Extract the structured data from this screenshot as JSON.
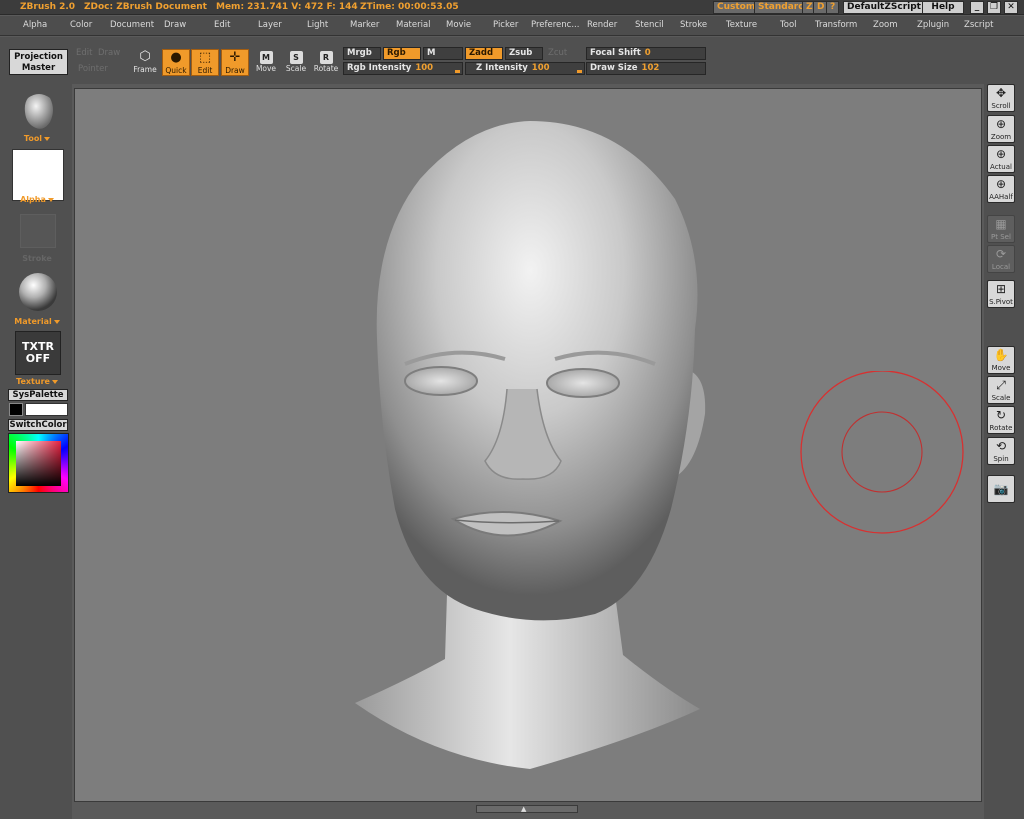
{
  "titlebar": {
    "app": "ZBrush 2.0",
    "doc": "ZDoc: ZBrush Document",
    "mem": "Mem: 231.741  V: 472  F: 144",
    "ztime": "ZTime: 00:00:53.05",
    "custom": "Custom",
    "standard": "Standard",
    "z": "Z",
    "d": "D",
    "help_q": "?",
    "script": "DefaultZScript",
    "help": "Help",
    "win_min": "_",
    "win_restore": "❐",
    "win_close": "✕"
  },
  "menu": [
    "Alpha",
    "Color",
    "Document",
    "Draw",
    "Edit",
    "Layer",
    "Light",
    "Marker",
    "Material",
    "Movie",
    "Picker",
    "Preferenc...",
    "Render",
    "Stencil",
    "Stroke",
    "Texture",
    "Tool",
    "Transform",
    "Zoom",
    "Zplugin",
    "Zscript"
  ],
  "toolbar": {
    "projection_master_line1": "Projection",
    "projection_master_line2": "Master",
    "faded_edit": "Edit",
    "faded_draw": "Draw",
    "faded_pointer": "Pointer",
    "frame": "Frame",
    "quick": "Quick",
    "edit": "Edit",
    "draw": "Draw",
    "move": "Move",
    "move_key": "M",
    "scale": "Scale",
    "scale_key": "S",
    "rotate": "Rotate",
    "rotate_key": "R",
    "mrgb": "Mrgb",
    "rgb": "Rgb",
    "m": "M",
    "zadd": "Zadd",
    "zsub": "Zsub",
    "zcut": "Zcut",
    "rgb_intensity_label": "Rgb Intensity",
    "rgb_intensity_value": "100",
    "z_intensity_label": "Z Intensity",
    "z_intensity_value": "100",
    "focal_shift_label": "Focal Shift",
    "focal_shift_value": "0",
    "draw_size_label": "Draw Size",
    "draw_size_value": "102"
  },
  "leftpanel": {
    "tool": "Tool",
    "alpha": "Alpha",
    "stroke_faded": "Stroke",
    "material": "Material",
    "txtr_line1": "TXTR",
    "txtr_line2": "OFF",
    "texture": "Texture",
    "syspalette": "SysPalette",
    "switchcolor": "SwitchColor"
  },
  "rightpanel": [
    {
      "label": "Scroll",
      "icon": "✥",
      "dim": false
    },
    {
      "label": "Zoom",
      "icon": "⊕",
      "dim": false
    },
    {
      "label": "Actual",
      "icon": "⊕",
      "dim": false
    },
    {
      "label": "AAHalf",
      "icon": "⊕",
      "dim": false
    },
    {
      "label": "Pt Sel",
      "icon": "▦",
      "dim": true
    },
    {
      "label": "Local",
      "icon": "⟳",
      "dim": true
    },
    {
      "label": "S.Pivot",
      "icon": "⊞",
      "dim": false
    },
    {
      "label": "Move",
      "icon": "✋",
      "dim": false
    },
    {
      "label": "Scale",
      "icon": "⤢",
      "dim": false
    },
    {
      "label": "Rotate",
      "icon": "↻",
      "dim": false
    },
    {
      "label": "Spin",
      "icon": "⟲",
      "dim": false
    },
    {
      "label": "",
      "icon": "📷",
      "dim": false
    }
  ],
  "colors": {
    "accent": "#f09a2a",
    "cursor": "#d83030",
    "canvas": "#7d7d7d"
  }
}
